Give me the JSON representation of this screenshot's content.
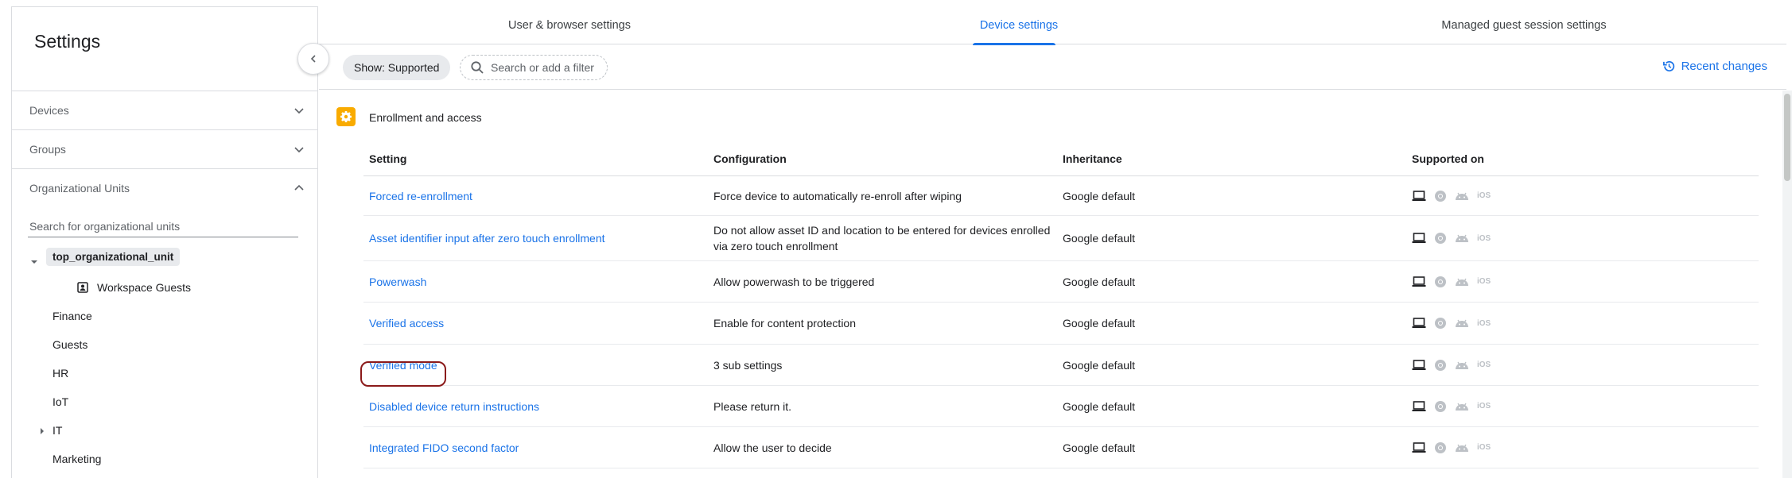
{
  "sidebar": {
    "title": "Settings",
    "sections": [
      {
        "label": "Devices",
        "expanded": false
      },
      {
        "label": "Groups",
        "expanded": false
      },
      {
        "label": "Organizational Units",
        "expanded": true
      }
    ],
    "ou_search_placeholder": "Search for organizational units",
    "tree": {
      "root": "top_organizational_unit",
      "guests_node": "Workspace Guests",
      "children": [
        "Finance",
        "Guests",
        "HR",
        "IoT",
        "IT",
        "Marketing"
      ]
    }
  },
  "tabs": [
    {
      "label": "User & browser settings",
      "active": false
    },
    {
      "label": "Device settings",
      "active": true
    },
    {
      "label": "Managed guest session settings",
      "active": false
    }
  ],
  "filter": {
    "chip_label": "Show: Supported",
    "search_placeholder": "Search or add a filter",
    "recent_changes": "Recent changes"
  },
  "section": {
    "title": "Enrollment and access",
    "icon": "gear-icon",
    "icon_color": "#f9ab00"
  },
  "table": {
    "headers": [
      "Setting",
      "Configuration",
      "Inheritance",
      "Supported on"
    ],
    "rows": [
      {
        "setting": "Forced re-enrollment",
        "configuration": "Force device to automatically re-enroll after wiping",
        "inheritance": "Google default"
      },
      {
        "setting": "Asset identifier input after zero touch enrollment",
        "configuration": "Do not allow asset ID and location to be entered for devices enrolled via zero touch enrollment",
        "inheritance": "Google default"
      },
      {
        "setting": "Powerwash",
        "configuration": "Allow powerwash to be triggered",
        "inheritance": "Google default"
      },
      {
        "setting": "Verified access",
        "configuration": "Enable for content protection",
        "inheritance": "Google default"
      },
      {
        "setting": "Verified mode",
        "configuration": "3 sub settings",
        "inheritance": "Google default"
      },
      {
        "setting": "Disabled device return instructions",
        "configuration": "Please return it.",
        "inheritance": "Google default"
      },
      {
        "setting": "Integrated FIDO second factor",
        "configuration": "Allow the user to decide",
        "inheritance": "Google default"
      }
    ],
    "support_icons": [
      "laptop-icon",
      "chrome-icon",
      "android-icon",
      "ios-icon"
    ],
    "ios_label": "iOS"
  },
  "colors": {
    "accent": "#1a73e8",
    "highlight": "#8b1a1a"
  }
}
